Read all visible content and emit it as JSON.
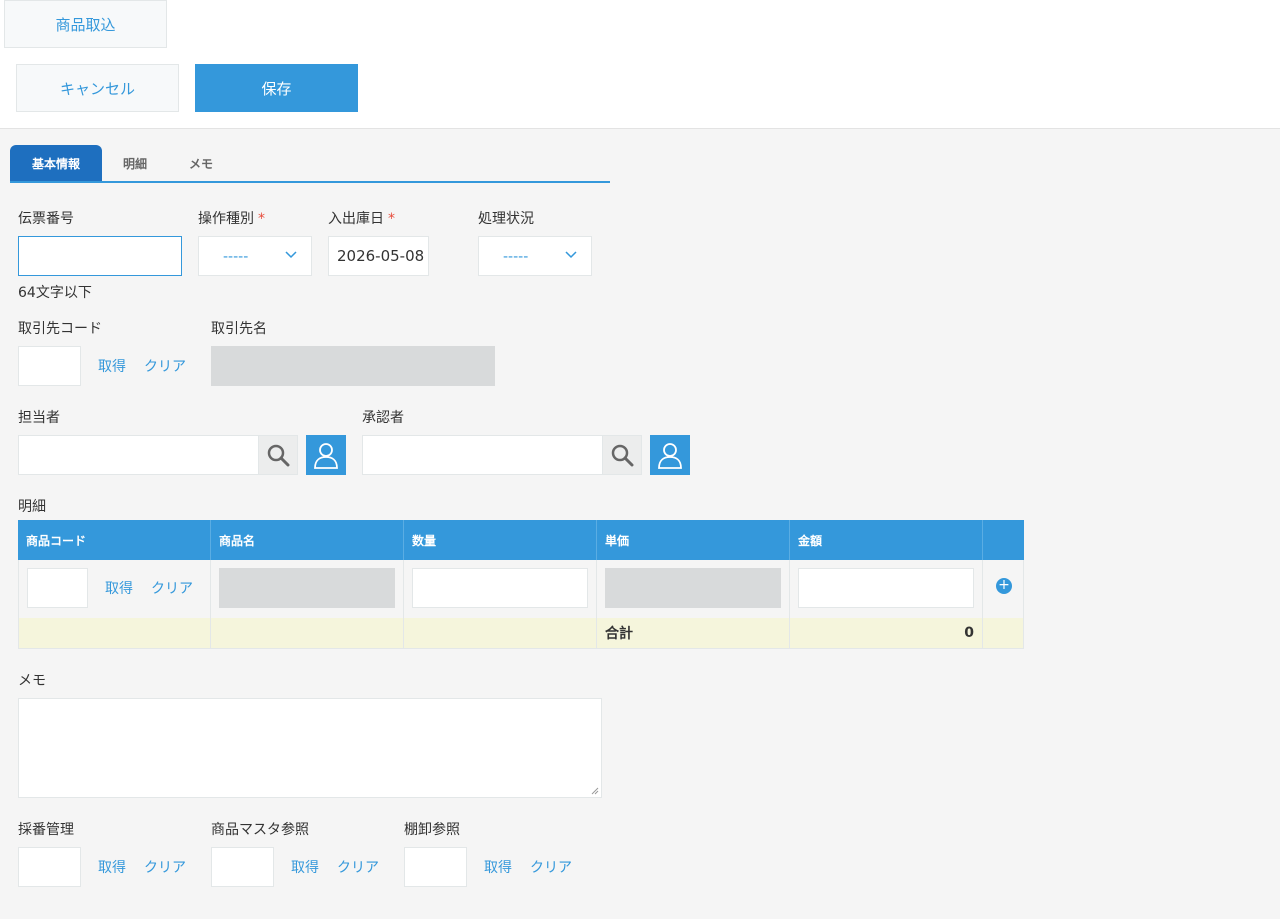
{
  "header": {
    "import_label": "商品取込",
    "cancel_label": "キャンセル",
    "save_label": "保存"
  },
  "tabs": [
    {
      "label": "基本情報",
      "active": true
    },
    {
      "label": "明細",
      "active": false
    },
    {
      "label": "メモ",
      "active": false
    }
  ],
  "fields": {
    "slip_no": {
      "label": "伝票番号",
      "value": "",
      "hint": "64文字以下"
    },
    "operation_type": {
      "label": "操作種別",
      "required_mark": "*",
      "value": "-----"
    },
    "inout_date": {
      "label": "入出庫日",
      "required_mark": "*",
      "value": "2026-05-08"
    },
    "status": {
      "label": "処理状況",
      "value": "-----"
    },
    "partner_code": {
      "label": "取引先コード",
      "value": ""
    },
    "partner_name": {
      "label": "取引先名",
      "value": ""
    },
    "person_in_charge": {
      "label": "担当者",
      "value": ""
    },
    "approver": {
      "label": "承認者",
      "value": ""
    }
  },
  "links": {
    "get": "取得",
    "clear": "クリア"
  },
  "details": {
    "section_label": "明細",
    "columns": [
      "商品コード",
      "商品名",
      "数量",
      "単価",
      "金額"
    ],
    "rows": [
      {
        "code": "",
        "name": "",
        "qty": "",
        "unit_price": "",
        "amount": ""
      }
    ],
    "total_label": "合計",
    "total_value": "0",
    "add_symbol": "+"
  },
  "memo": {
    "label": "メモ",
    "value": ""
  },
  "lookups": {
    "numbering": {
      "label": "採番管理"
    },
    "product_master": {
      "label": "商品マスタ参照"
    },
    "stocktake": {
      "label": "棚卸参照"
    }
  },
  "colors": {
    "accent": "#3498db",
    "required": "#e74c3c",
    "total_row": "#f5f5dc"
  },
  "icons": {
    "search": "search-icon",
    "user": "user-icon",
    "chevron": "chevron-down-icon",
    "add": "plus-circle-icon"
  }
}
